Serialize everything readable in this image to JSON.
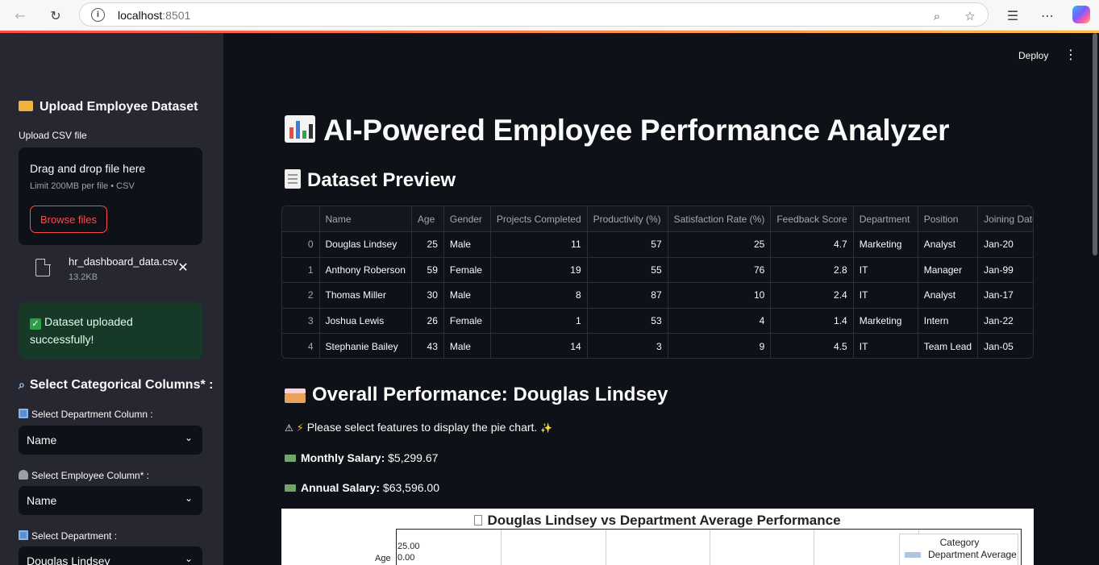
{
  "browser": {
    "url_host": "localhost",
    "url_port": ":8501"
  },
  "header": {
    "deploy_label": "Deploy",
    "menu_glyph": "⋮"
  },
  "sidebar": {
    "upload_heading": "Upload Employee Dataset",
    "upload_label": "Upload CSV file",
    "dropzone_title": "Drag and drop file here",
    "dropzone_limit": "Limit 200MB per file • CSV",
    "browse_label": "Browse files",
    "file_name": "hr_dashboard_data.csv",
    "file_size": "13.2KB",
    "success_message": "Dataset uploaded successfully!",
    "categorical_heading": "Select Categorical Columns* :",
    "department_column_label": "Select Department Column :",
    "department_column_value": "Name",
    "employee_column_label": "Select Employee Column* :",
    "employee_column_value": "Name",
    "department_label": "Select Department :",
    "department_value": "Douglas Lindsey"
  },
  "main": {
    "title": "AI-Powered Employee Performance Analyzer",
    "preview_heading": "Dataset Preview",
    "table": {
      "columns": [
        "",
        "Name",
        "Age",
        "Gender",
        "Projects Completed",
        "Productivity (%)",
        "Satisfaction Rate (%)",
        "Feedback Score",
        "Department",
        "Position",
        "Joining Date"
      ],
      "rows": [
        [
          "0",
          "Douglas Lindsey",
          "25",
          "Male",
          "11",
          "57",
          "25",
          "4.7",
          "Marketing",
          "Analyst",
          "Jan-20"
        ],
        [
          "1",
          "Anthony Roberson",
          "59",
          "Female",
          "19",
          "55",
          "76",
          "2.8",
          "IT",
          "Manager",
          "Jan-99"
        ],
        [
          "2",
          "Thomas Miller",
          "30",
          "Male",
          "8",
          "87",
          "10",
          "2.4",
          "IT",
          "Analyst",
          "Jan-17"
        ],
        [
          "3",
          "Joshua Lewis",
          "26",
          "Female",
          "1",
          "53",
          "4",
          "1.4",
          "Marketing",
          "Intern",
          "Jan-22"
        ],
        [
          "4",
          "Stephanie Bailey",
          "43",
          "Male",
          "14",
          "3",
          "9",
          "4.5",
          "IT",
          "Team Lead",
          "Jan-05"
        ]
      ]
    },
    "overall_heading": "Overall Performance: Douglas Lindsey",
    "warning_text": "Please select features to display the pie chart.",
    "monthly_label": "Monthly Salary:",
    "monthly_value": "$5,299.67",
    "annual_label": "Annual Salary:",
    "annual_value": "$63,596.00"
  },
  "chart_data": {
    "type": "bar",
    "title": "Douglas Lindsey vs Department Average Performance",
    "categories": [
      "Age"
    ],
    "x_ticks": [
      "25.00",
      "0.00"
    ],
    "legend_title": "Category",
    "series": [
      {
        "name": "Department Average",
        "values": [
          25.0
        ],
        "color": "#a9c5e8"
      }
    ],
    "legend_position": "top-right"
  }
}
